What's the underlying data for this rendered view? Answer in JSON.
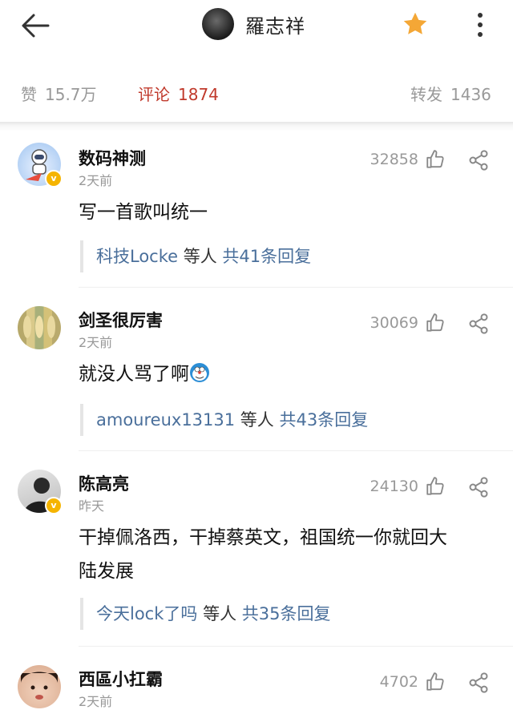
{
  "header": {
    "profile_name": "羅志祥",
    "icons": {
      "back": "arrow-left-icon",
      "favorite": "star-icon",
      "more": "more-vertical-icon"
    },
    "colors": {
      "star": "#F4A736"
    }
  },
  "stats": {
    "likes_label": "赞",
    "likes_value": "15.7万",
    "comments_label": "评论",
    "comments_value": "1874",
    "reposts_label": "转发",
    "reposts_value": "1436",
    "active_color": "#C0392B"
  },
  "comments": [
    {
      "name": "数码神测",
      "time": "2天前",
      "likes": "32858",
      "verified": true,
      "text": "写一首歌叫统一",
      "reply_users": "科技Locke",
      "reply_mid": " 等人 ",
      "reply_count": "共41条回复"
    },
    {
      "name": "剑圣很厉害",
      "time": "2天前",
      "likes": "30069",
      "verified": false,
      "text": "就没人骂了啊",
      "reply_users": "amoureux13131",
      "reply_mid": " 等人 ",
      "reply_count": "共43条回复"
    },
    {
      "name": "陈高亮",
      "time": "昨天",
      "likes": "24130",
      "verified": true,
      "text_line1": "干掉佩洛西，干掉蔡英文，祖国统一你就回大",
      "text_line2": "陆发展",
      "reply_users": "今天lock了吗",
      "reply_mid": " 等人 ",
      "reply_count": "共35条回复"
    },
    {
      "name": "西區小扛霸",
      "time": "2天前",
      "likes": "4702",
      "verified": false
    }
  ]
}
